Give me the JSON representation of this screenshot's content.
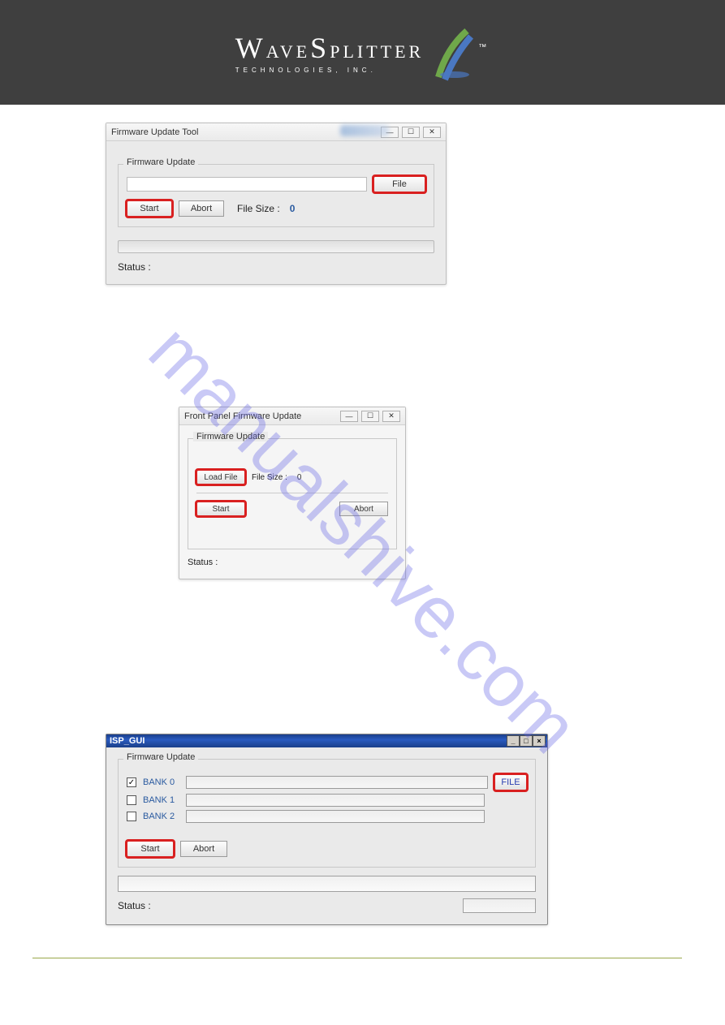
{
  "header": {
    "brand_top": "WAVESPLITTER",
    "brand_sub": "TECHNOLOGIES, INC.",
    "tm": "™"
  },
  "watermark": "manualshive.com",
  "dialog1": {
    "title": "Firmware Update Tool",
    "group_label": "Firmware Update",
    "file_button": "File",
    "start_button": "Start",
    "abort_button": "Abort",
    "filesize_label": "File Size :",
    "filesize_value": "0",
    "status_label": "Status :"
  },
  "dialog2": {
    "title": "Front Panel Firmware Update",
    "group_label": "Firmware Update",
    "load_button": "Load File",
    "filesize_label": "File Size :",
    "filesize_value": "0",
    "start_button": "Start",
    "abort_button": "Abort",
    "status_label": "Status :"
  },
  "dialog3": {
    "title": "ISP_GUI",
    "group_label": "Firmware Update",
    "bank0_label": "BANK 0",
    "bank1_label": "BANK 1",
    "bank2_label": "BANK 2",
    "bank0_checked": true,
    "bank1_checked": false,
    "bank2_checked": false,
    "file_button": "FILE",
    "start_button": "Start",
    "abort_button": "Abort",
    "status_label": "Status :"
  },
  "win_controls": {
    "minimize": "—",
    "maximize": "☐",
    "close": "✕"
  }
}
